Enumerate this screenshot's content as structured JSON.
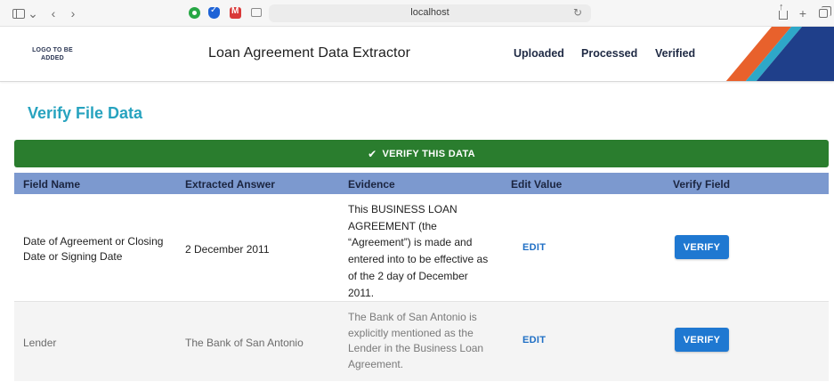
{
  "browser": {
    "url": "localhost",
    "icons": [
      "sidebar-icon",
      "chevron-down-icon",
      "back-icon",
      "forward-icon",
      "grammarly-icon",
      "shield-check-icon",
      "mail-icon",
      "reader-icon",
      "reload-icon",
      "share-icon",
      "new-tab-icon",
      "tabs-overview-icon"
    ]
  },
  "header": {
    "logo_placeholder": "LOGO TO BE ADDED",
    "title": "Loan Agreement Data Extractor",
    "nav": [
      "Uploaded",
      "Processed",
      "Verified"
    ],
    "accent_colors": [
      "#e8612c",
      "#2ea8c8",
      "#1f3f8a"
    ]
  },
  "page": {
    "title": "Verify File Data",
    "verify_all_label": "VERIFY THIS DATA"
  },
  "table": {
    "columns": [
      "Field Name",
      "Extracted Answer",
      "Evidence",
      "Edit Value",
      "Verify Field"
    ],
    "rows": [
      {
        "field": "Date of Agreement or Closing Date or Signing Date",
        "answer": "2 December 2011",
        "evidence": [
          "This BUSINESS LOAN",
          "AGREEMENT (the",
          "“Agreement”) is made and",
          "entered into to be effective as",
          "of the 2 day of December",
          "2011."
        ],
        "edit_label": "EDIT",
        "verify_label": "VERIFY"
      },
      {
        "field": "Lender",
        "answer": "The Bank of San Antonio",
        "evidence": [
          "The Bank of San Antonio is",
          "explicitly mentioned as the",
          "Lender in the Business Loan",
          "Agreement."
        ],
        "edit_label": "EDIT",
        "verify_label": "VERIFY"
      }
    ]
  },
  "colors": {
    "title_teal": "#27a3bf",
    "verify_bar_green": "#2a7d2e",
    "table_header_blue": "#7c99cf",
    "button_blue": "#1f78d1"
  }
}
